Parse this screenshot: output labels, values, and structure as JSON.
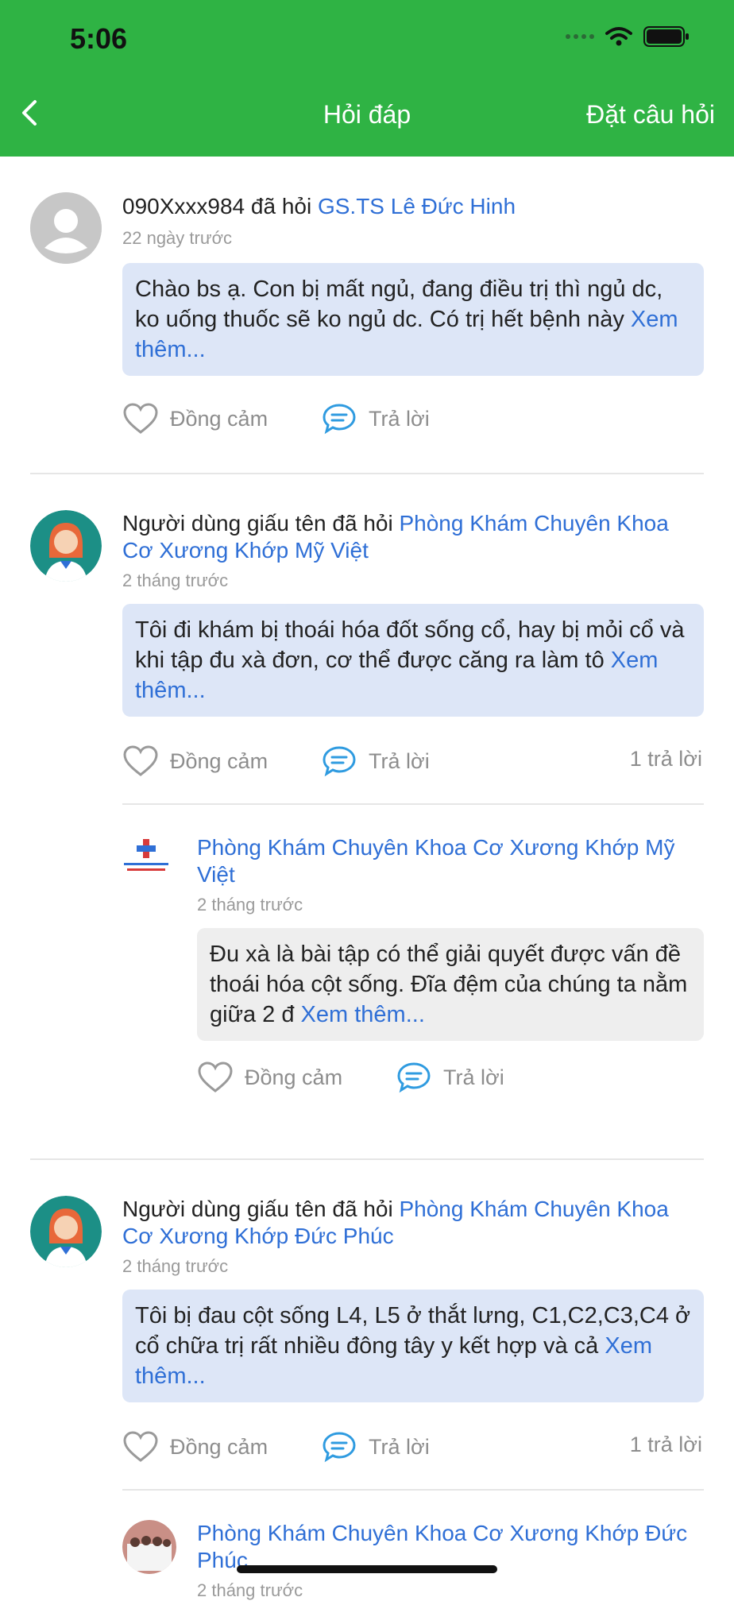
{
  "status_bar": {
    "time": "5:06"
  },
  "nav": {
    "title": "Hỏi đáp",
    "ask_button": "Đặt câu hỏi"
  },
  "actions": {
    "empathy": "Đồng cảm",
    "reply": "Trả lời"
  },
  "posts": [
    {
      "author": "090Xxxx984",
      "asked_text": "đã hỏi",
      "doctor": "GS.TS Lê Đức Hinh",
      "time": "22 ngày trước",
      "question": "Chào bs ạ. Con bị mất ngủ, đang điều trị thì ngủ dc, ko uống thuốc sẽ ko ngủ dc. Có trị hết bệnh này",
      "more": "Xem thêm..."
    },
    {
      "author": "Người dùng giấu tên",
      "asked_text": "đã hỏi",
      "doctor": "Phòng Khám Chuyên Khoa Cơ Xương Khớp Mỹ Việt",
      "time": "2 tháng trước",
      "question": "Tôi đi khám bị thoái hóa đốt sống cổ, hay bị mỏi cổ và khi tập đu xà đơn, cơ thể được căng ra làm tô",
      "more": "Xem thêm...",
      "reply_count": "1 trả lời",
      "reply": {
        "author": "Phòng Khám Chuyên Khoa Cơ Xương Khớp Mỹ Việt",
        "time": "2 tháng trước",
        "text": "Đu xà là bài tập có thể giải quyết được vấn đề thoái hóa cột sống. Đĩa đệm của chúng ta nằm giữa 2 đ",
        "more": "Xem thêm..."
      }
    },
    {
      "author": "Người dùng giấu tên",
      "asked_text": "đã hỏi",
      "doctor": "Phòng Khám Chuyên Khoa Cơ Xương Khớp Đức Phúc",
      "time": "2 tháng trước",
      "question": "Tôi bị đau cột sống L4, L5 ở thắt lưng, C1,C2,C3,C4 ở cổ chữa trị rất nhiều đông tây y kết hợp và cả",
      "more": "Xem thêm...",
      "reply_count": "1 trả lời",
      "reply": {
        "author": "Phòng Khám Chuyên Khoa Cơ Xương Khớp Đức Phúc",
        "time": "2 tháng trước"
      }
    }
  ],
  "colors": {
    "header": "#2fb344",
    "link": "#2f6fd6",
    "bubble": "#dde6f7",
    "reply_bubble": "#eeeeee"
  }
}
